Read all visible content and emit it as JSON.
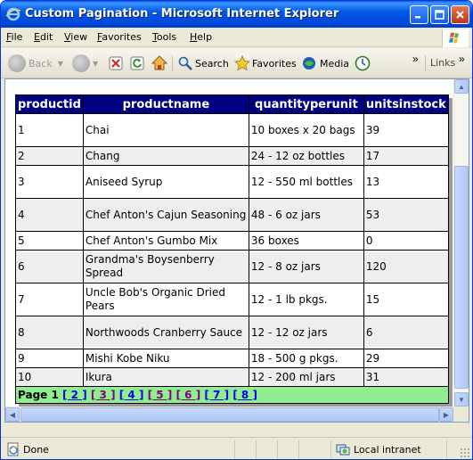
{
  "window": {
    "title": "Custom Pagination - Microsoft Internet Explorer"
  },
  "menubar": {
    "items": [
      "File",
      "Edit",
      "View",
      "Favorites",
      "Tools",
      "Help"
    ]
  },
  "toolbar": {
    "back_label": "Back",
    "search_label": "Search",
    "favorites_label": "Favorites",
    "media_label": "Media",
    "links_label": "Links",
    "overflow_glyph": "»"
  },
  "grid": {
    "columns": [
      "productid",
      "productname",
      "quantityperunit",
      "unitsinstock"
    ],
    "rows": [
      [
        "1",
        "Chai",
        "10 boxes x 20 bags",
        "39"
      ],
      [
        "2",
        "Chang",
        "24 - 12 oz bottles",
        "17"
      ],
      [
        "3",
        "Aniseed Syrup",
        "12 - 550 ml bottles",
        "13"
      ],
      [
        "4",
        "Chef Anton's Cajun Seasoning",
        "48 - 6 oz jars",
        "53"
      ],
      [
        "5",
        "Chef Anton's Gumbo Mix",
        "36 boxes",
        "0"
      ],
      [
        "6",
        "Grandma's Boysenberry Spread",
        "12 - 8 oz jars",
        "120"
      ],
      [
        "7",
        "Uncle Bob's Organic Dried Pears",
        "12 - 1 lb pkgs.",
        "15"
      ],
      [
        "8",
        "Northwoods Cranberry Sauce",
        "12 - 12 oz jars",
        "6"
      ],
      [
        "9",
        "Mishi Kobe Niku",
        "18 - 500 g pkgs.",
        "29"
      ],
      [
        "10",
        "Ikura",
        "12 - 200 ml jars",
        "31"
      ]
    ],
    "pager": {
      "current_label": "Page 1",
      "pages": [
        {
          "label": "[ 2 ]",
          "visited": false
        },
        {
          "label": "[ 3 ]",
          "visited": true
        },
        {
          "label": "[ 4 ]",
          "visited": false
        },
        {
          "label": "[ 5 ]",
          "visited": true
        },
        {
          "label": "[ 6 ]",
          "visited": true
        },
        {
          "label": "[ 7 ]",
          "visited": false
        },
        {
          "label": "[ 8 ]",
          "visited": false
        }
      ]
    }
  },
  "statusbar": {
    "status_text": "Done",
    "zone_text": "Local intranet"
  },
  "colors": {
    "header_bg": "#000080",
    "pager_bg": "#90ee90",
    "alt_row_bg": "#eeeeee",
    "link": "#0000ee",
    "visited_link": "#800080"
  },
  "icons": [
    "ie-logo-icon",
    "minimize-icon",
    "maximize-icon",
    "close-icon",
    "windows-flag-icon",
    "back-arrow-icon",
    "forward-arrow-icon",
    "stop-icon",
    "refresh-icon",
    "home-icon",
    "search-icon",
    "favorites-star-icon",
    "media-icon",
    "history-icon",
    "page-done-icon",
    "intranet-zone-icon"
  ]
}
